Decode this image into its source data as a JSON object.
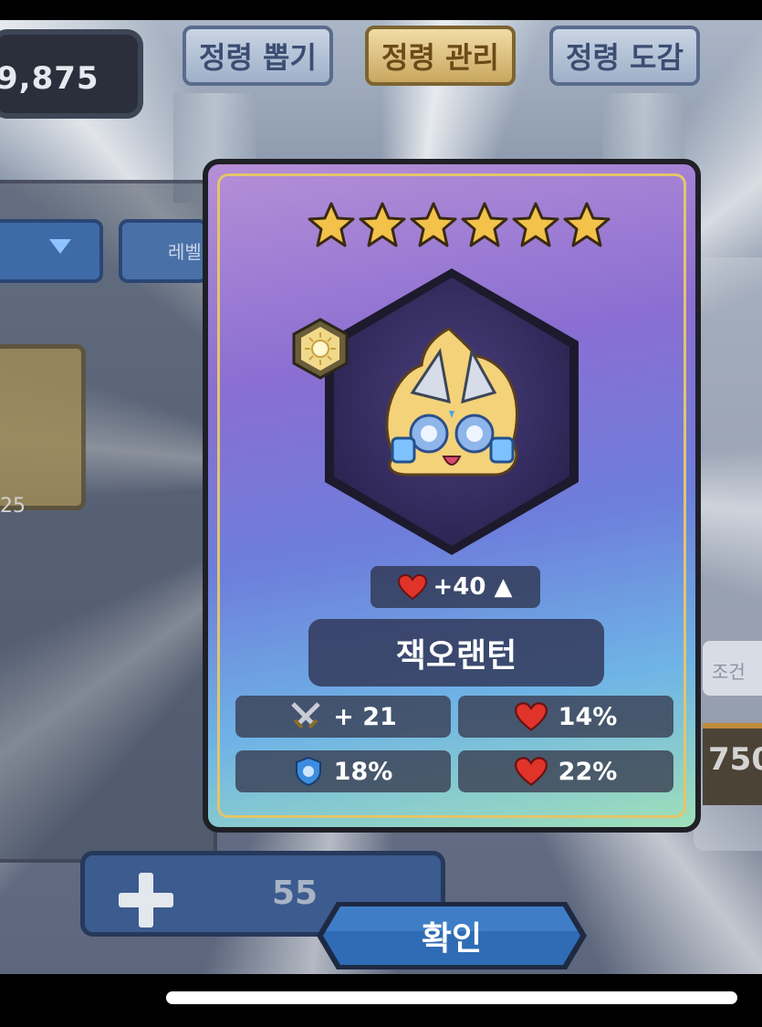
{
  "header": {
    "currency": "9,875",
    "tabs": [
      {
        "label": "정령 뽑기",
        "active": false
      },
      {
        "label": "정령 관리",
        "active": true
      },
      {
        "label": "정령 도감",
        "active": false
      }
    ]
  },
  "background": {
    "filter_label_left": "레벨",
    "card_left_number": "25",
    "right_condition": "조건",
    "right_number": "750",
    "bottom_number": "55"
  },
  "result_card": {
    "stars": 6,
    "hp_bonus": "+40 ▲",
    "name": "잭오랜턴",
    "stats": [
      {
        "icon": "swords-icon",
        "value": "+ 21"
      },
      {
        "icon": "heart-icon",
        "value": "14%"
      },
      {
        "icon": "shield-icon",
        "value": "18%"
      },
      {
        "icon": "heart-icon",
        "value": "22%"
      }
    ]
  },
  "confirm_label": "확인",
  "colors": {
    "gold": "#f2c24a",
    "card_frame": "#e3c56a",
    "confirm_button": "#2f6cb5"
  }
}
